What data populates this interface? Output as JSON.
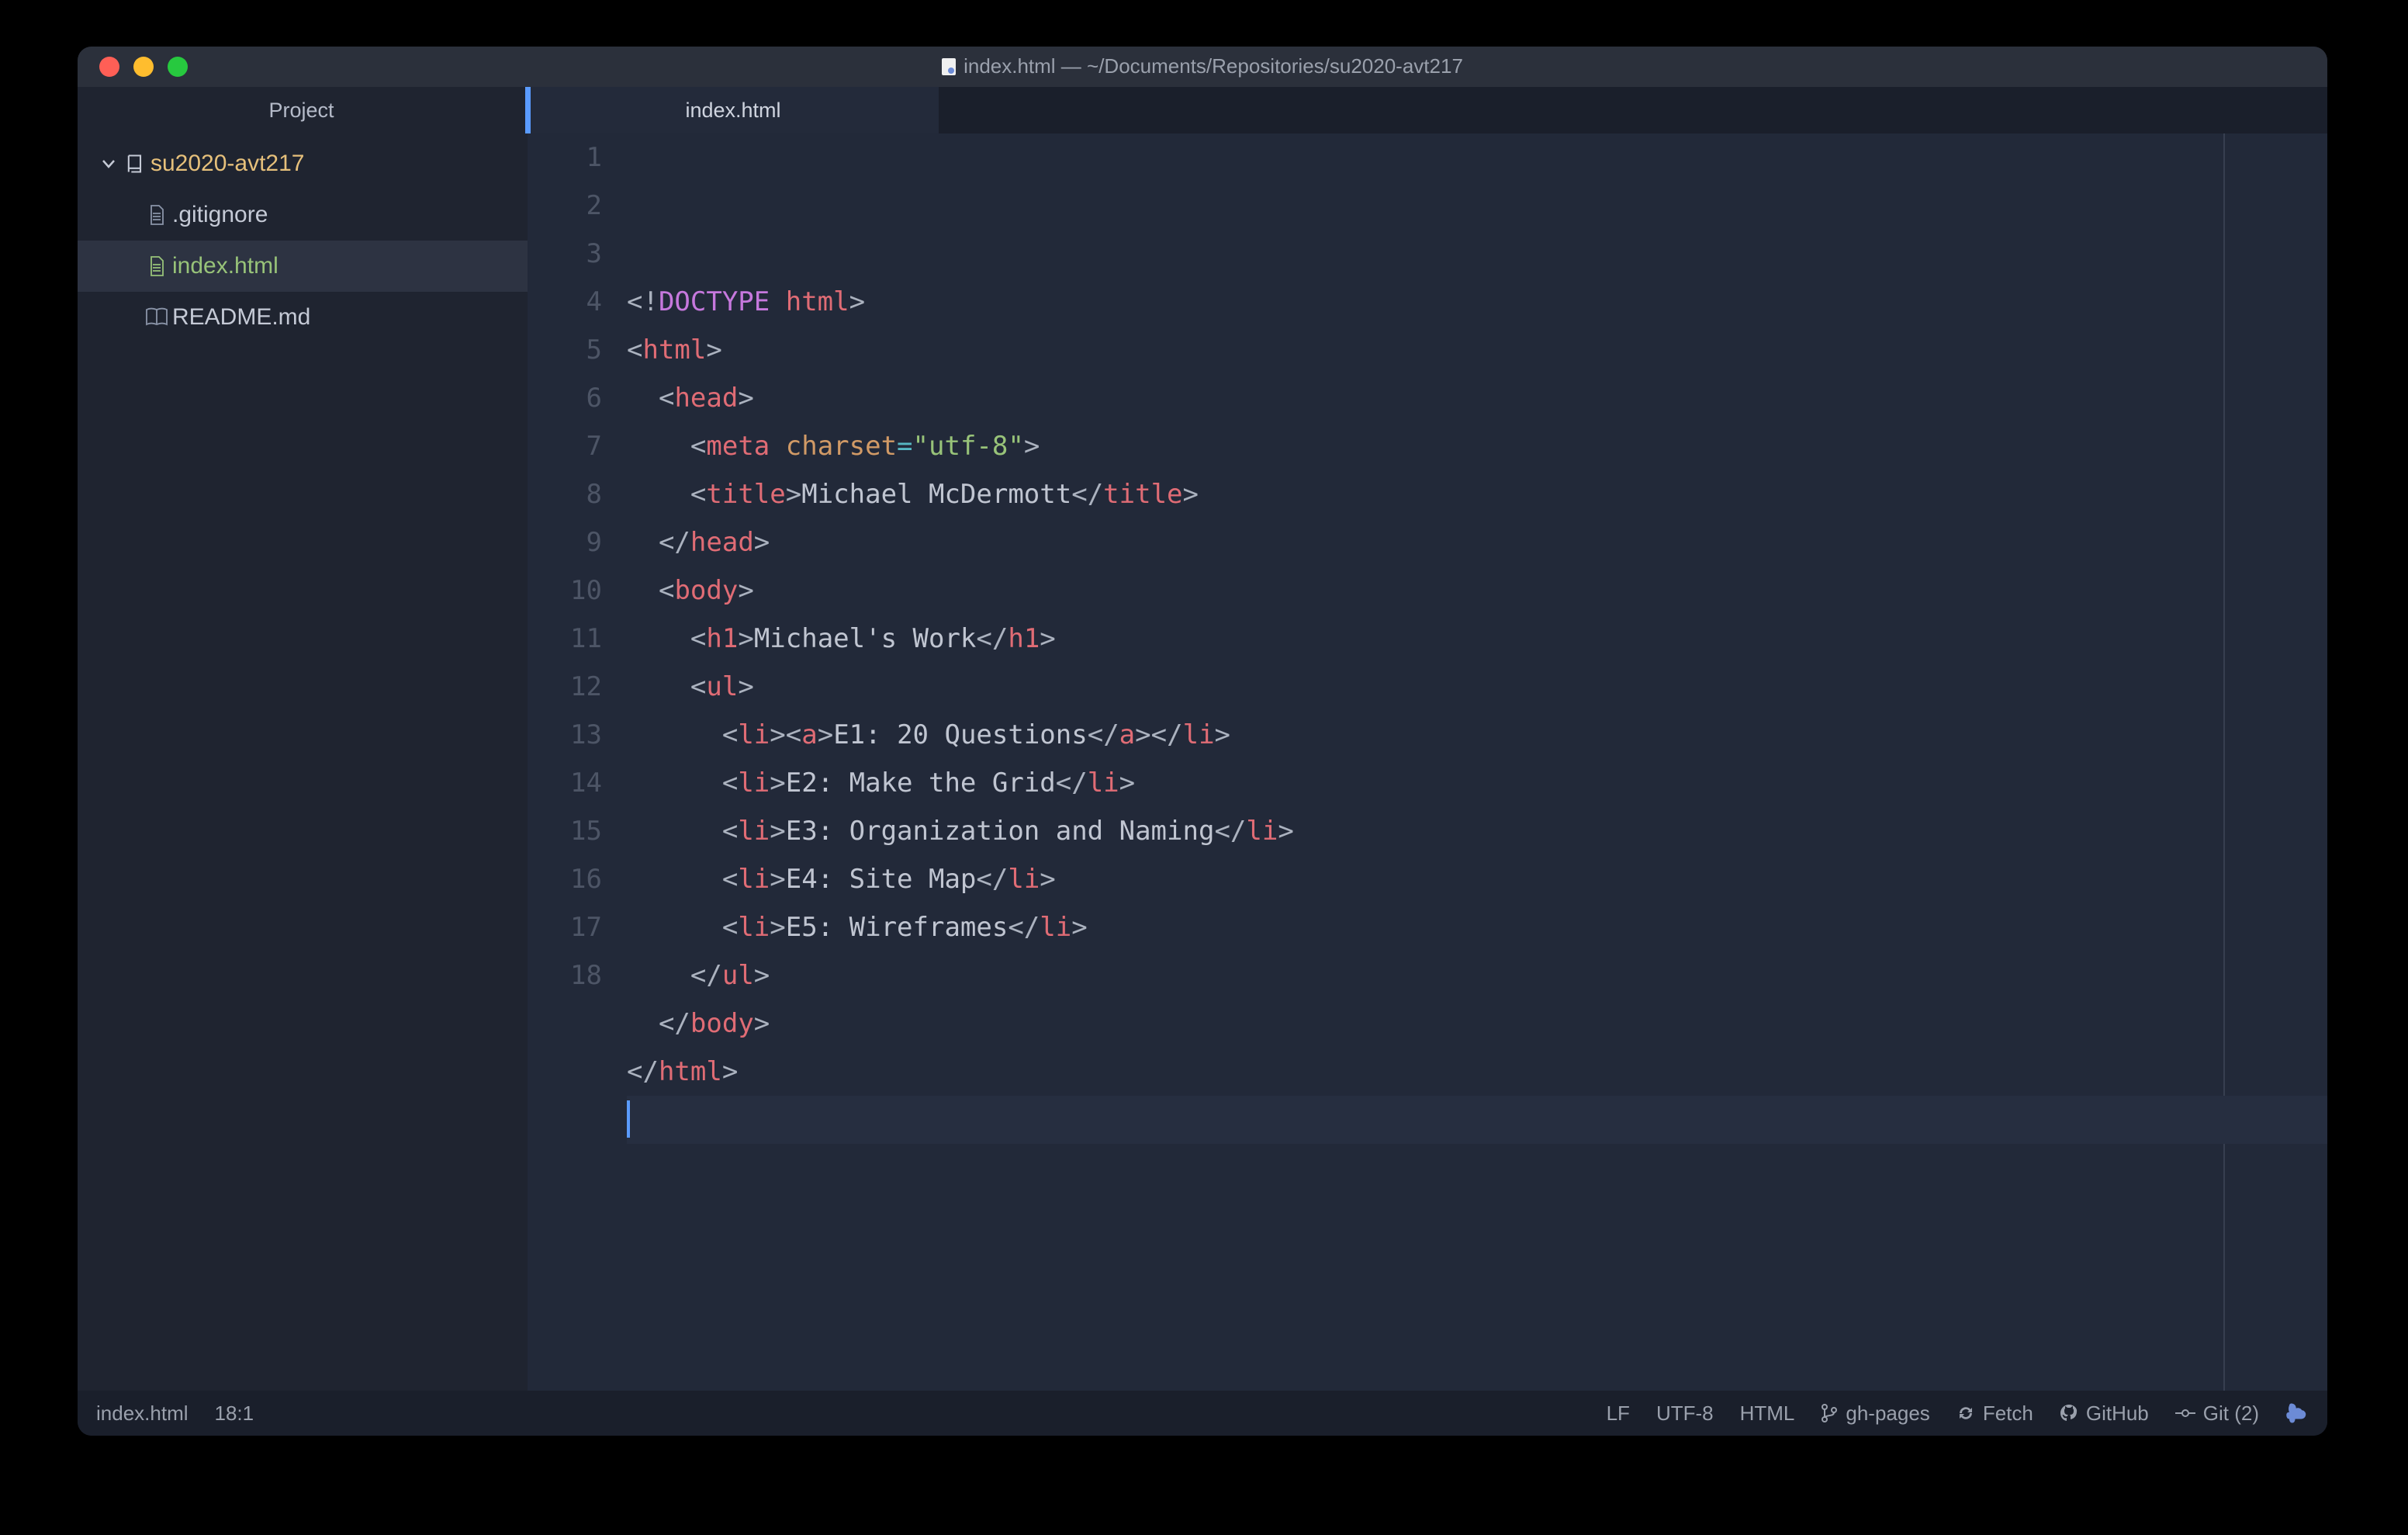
{
  "titlebar": {
    "title": "index.html — ~/Documents/Repositories/su2020-avt217"
  },
  "sidebar": {
    "header": "Project",
    "root": {
      "name": "su2020-avt217"
    },
    "files": [
      {
        "name": ".gitignore",
        "icon": "file",
        "status": "clean"
      },
      {
        "name": "index.html",
        "icon": "file",
        "status": "modified",
        "selected": true
      },
      {
        "name": "README.md",
        "icon": "book",
        "status": "clean"
      }
    ]
  },
  "tab": {
    "label": "index.html"
  },
  "editor": {
    "line_numbers": [
      "1",
      "2",
      "3",
      "4",
      "5",
      "6",
      "7",
      "8",
      "9",
      "10",
      "11",
      "12",
      "13",
      "14",
      "15",
      "16",
      "17",
      "18"
    ],
    "active_line": 18,
    "lines": [
      {
        "tokens": [
          {
            "c": "d",
            "t": "<!"
          },
          {
            "c": "dk",
            "t": "DOCTYPE"
          },
          {
            "c": "d",
            "t": " "
          },
          {
            "c": "dh",
            "t": "html"
          },
          {
            "c": "d",
            "t": ">"
          }
        ]
      },
      {
        "tokens": [
          {
            "c": "p",
            "t": "<"
          },
          {
            "c": "t",
            "t": "html"
          },
          {
            "c": "p",
            "t": ">"
          }
        ]
      },
      {
        "tokens": [
          {
            "c": "x",
            "t": "  "
          },
          {
            "c": "p",
            "t": "<"
          },
          {
            "c": "t",
            "t": "head"
          },
          {
            "c": "p",
            "t": ">"
          }
        ]
      },
      {
        "tokens": [
          {
            "c": "x",
            "t": "    "
          },
          {
            "c": "p",
            "t": "<"
          },
          {
            "c": "t",
            "t": "meta"
          },
          {
            "c": "x",
            "t": " "
          },
          {
            "c": "a",
            "t": "charset"
          },
          {
            "c": "o",
            "t": "="
          },
          {
            "c": "s",
            "t": "\"utf-8\""
          },
          {
            "c": "p",
            "t": ">"
          }
        ]
      },
      {
        "tokens": [
          {
            "c": "x",
            "t": "    "
          },
          {
            "c": "p",
            "t": "<"
          },
          {
            "c": "t",
            "t": "title"
          },
          {
            "c": "p",
            "t": ">"
          },
          {
            "c": "x",
            "t": "Michael McDermott"
          },
          {
            "c": "p",
            "t": "</"
          },
          {
            "c": "t",
            "t": "title"
          },
          {
            "c": "p",
            "t": ">"
          }
        ]
      },
      {
        "tokens": [
          {
            "c": "x",
            "t": "  "
          },
          {
            "c": "p",
            "t": "</"
          },
          {
            "c": "t",
            "t": "head"
          },
          {
            "c": "p",
            "t": ">"
          }
        ]
      },
      {
        "tokens": [
          {
            "c": "x",
            "t": "  "
          },
          {
            "c": "p",
            "t": "<"
          },
          {
            "c": "t",
            "t": "body"
          },
          {
            "c": "p",
            "t": ">"
          }
        ]
      },
      {
        "tokens": [
          {
            "c": "x",
            "t": "    "
          },
          {
            "c": "p",
            "t": "<"
          },
          {
            "c": "t",
            "t": "h1"
          },
          {
            "c": "p",
            "t": ">"
          },
          {
            "c": "x",
            "t": "Michael's Work"
          },
          {
            "c": "p",
            "t": "</"
          },
          {
            "c": "t",
            "t": "h1"
          },
          {
            "c": "p",
            "t": ">"
          }
        ]
      },
      {
        "tokens": [
          {
            "c": "x",
            "t": "    "
          },
          {
            "c": "p",
            "t": "<"
          },
          {
            "c": "t",
            "t": "ul"
          },
          {
            "c": "p",
            "t": ">"
          }
        ]
      },
      {
        "tokens": [
          {
            "c": "x",
            "t": "      "
          },
          {
            "c": "p",
            "t": "<"
          },
          {
            "c": "t",
            "t": "li"
          },
          {
            "c": "p",
            "t": ">"
          },
          {
            "c": "p",
            "t": "<"
          },
          {
            "c": "t",
            "t": "a"
          },
          {
            "c": "p",
            "t": ">"
          },
          {
            "c": "x",
            "t": "E1: 20 Questions"
          },
          {
            "c": "p",
            "t": "</"
          },
          {
            "c": "t",
            "t": "a"
          },
          {
            "c": "p",
            "t": ">"
          },
          {
            "c": "p",
            "t": "</"
          },
          {
            "c": "t",
            "t": "li"
          },
          {
            "c": "p",
            "t": ">"
          }
        ]
      },
      {
        "tokens": [
          {
            "c": "x",
            "t": "      "
          },
          {
            "c": "p",
            "t": "<"
          },
          {
            "c": "t",
            "t": "li"
          },
          {
            "c": "p",
            "t": ">"
          },
          {
            "c": "x",
            "t": "E2: Make the Grid"
          },
          {
            "c": "p",
            "t": "</"
          },
          {
            "c": "t",
            "t": "li"
          },
          {
            "c": "p",
            "t": ">"
          }
        ]
      },
      {
        "tokens": [
          {
            "c": "x",
            "t": "      "
          },
          {
            "c": "p",
            "t": "<"
          },
          {
            "c": "t",
            "t": "li"
          },
          {
            "c": "p",
            "t": ">"
          },
          {
            "c": "x",
            "t": "E3: Organization and Naming"
          },
          {
            "c": "p",
            "t": "</"
          },
          {
            "c": "t",
            "t": "li"
          },
          {
            "c": "p",
            "t": ">"
          }
        ]
      },
      {
        "tokens": [
          {
            "c": "x",
            "t": "      "
          },
          {
            "c": "p",
            "t": "<"
          },
          {
            "c": "t",
            "t": "li"
          },
          {
            "c": "p",
            "t": ">"
          },
          {
            "c": "x",
            "t": "E4: Site Map"
          },
          {
            "c": "p",
            "t": "</"
          },
          {
            "c": "t",
            "t": "li"
          },
          {
            "c": "p",
            "t": ">"
          }
        ]
      },
      {
        "tokens": [
          {
            "c": "x",
            "t": "      "
          },
          {
            "c": "p",
            "t": "<"
          },
          {
            "c": "t",
            "t": "li"
          },
          {
            "c": "p",
            "t": ">"
          },
          {
            "c": "x",
            "t": "E5: Wireframes"
          },
          {
            "c": "p",
            "t": "</"
          },
          {
            "c": "t",
            "t": "li"
          },
          {
            "c": "p",
            "t": ">"
          }
        ]
      },
      {
        "tokens": [
          {
            "c": "x",
            "t": "    "
          },
          {
            "c": "p",
            "t": "</"
          },
          {
            "c": "t",
            "t": "ul"
          },
          {
            "c": "p",
            "t": ">"
          }
        ]
      },
      {
        "tokens": [
          {
            "c": "x",
            "t": "  "
          },
          {
            "c": "p",
            "t": "</"
          },
          {
            "c": "t",
            "t": "body"
          },
          {
            "c": "p",
            "t": ">"
          }
        ]
      },
      {
        "tokens": [
          {
            "c": "p",
            "t": "</"
          },
          {
            "c": "t",
            "t": "html"
          },
          {
            "c": "p",
            "t": ">"
          }
        ]
      },
      {
        "tokens": []
      }
    ]
  },
  "statusbar": {
    "left": {
      "file": "index.html",
      "position": "18:1"
    },
    "right": {
      "line_ending": "LF",
      "encoding": "UTF-8",
      "grammar": "HTML",
      "branch": "gh-pages",
      "fetch": "Fetch",
      "github": "GitHub",
      "git": "Git (2)"
    }
  }
}
